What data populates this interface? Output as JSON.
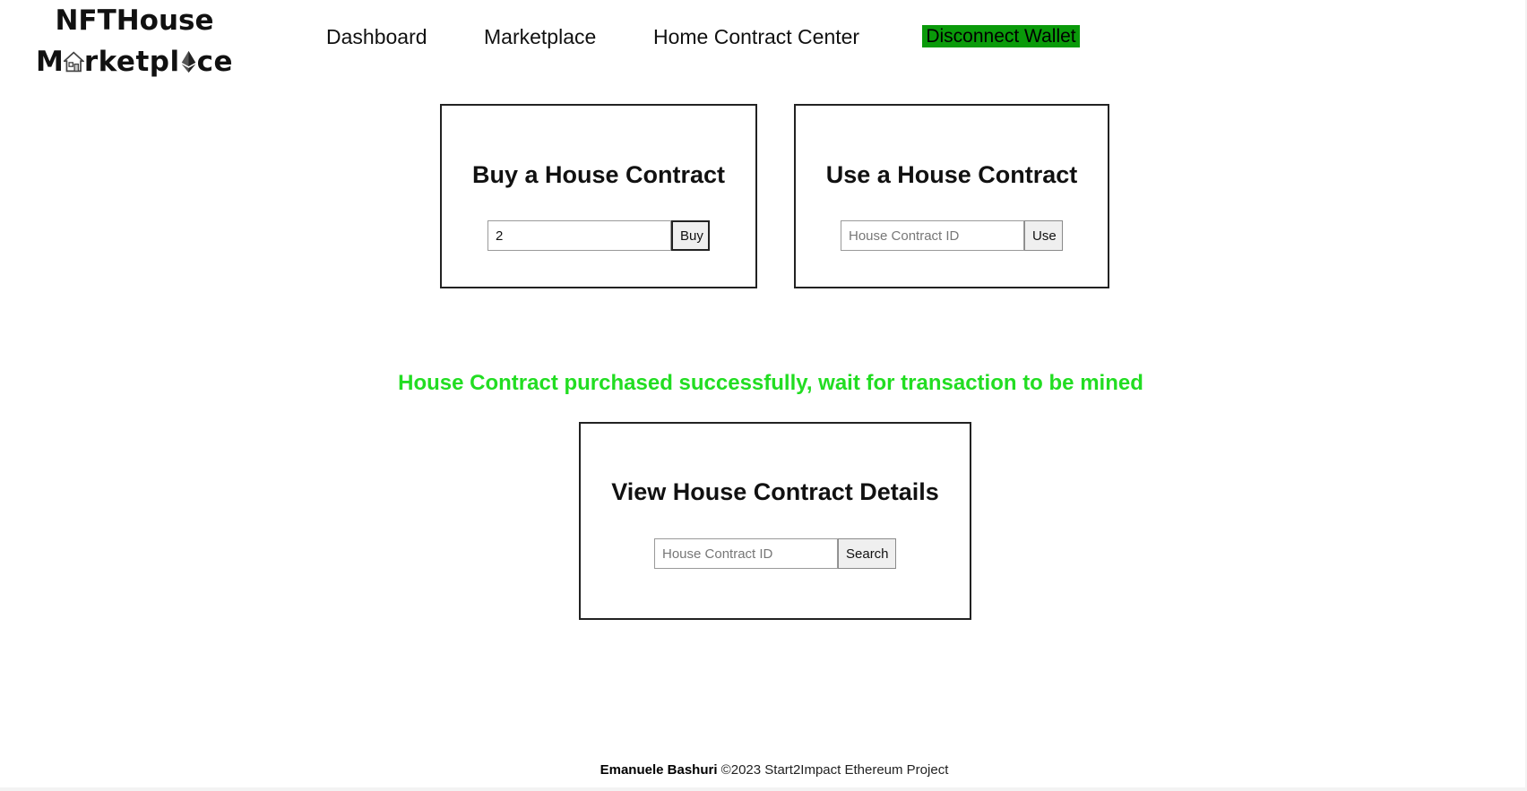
{
  "logo": {
    "line1": "NFTHouse",
    "line2_prefix": "M",
    "line2_mid": "rketpl",
    "line2_suffix": "ce",
    "icons": [
      "house-icon",
      "ethereum-icon"
    ]
  },
  "nav": {
    "items": [
      {
        "label": "Dashboard"
      },
      {
        "label": "Marketplace"
      },
      {
        "label": "Home Contract Center"
      }
    ],
    "wallet_button": "Disconnect Wallet"
  },
  "buy_card": {
    "title": "Buy a House Contract",
    "input_value": "2",
    "button": "Buy"
  },
  "use_card": {
    "title": "Use a House Contract",
    "placeholder": "House Contract ID",
    "button": "Use"
  },
  "status_message": "House Contract purchased successfully, wait for transaction to be mined",
  "view_card": {
    "title": "View House Contract Details",
    "placeholder": "House Contract ID",
    "button": "Search"
  },
  "footer": {
    "author": "Emanuele Bashuri",
    "text": " ©2023 Start2Impact Ethereum Project"
  },
  "colors": {
    "wallet_button_bg": "#0a9a0a",
    "status_text": "#22dd22"
  }
}
